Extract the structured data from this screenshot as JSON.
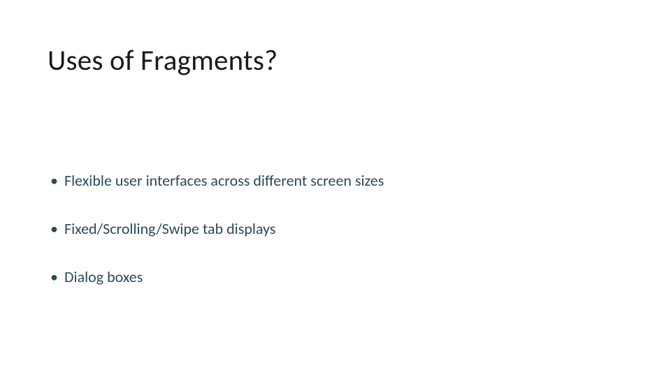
{
  "title": "Uses of Fragments?",
  "bullets": [
    "Flexible user interfaces across different screen sizes",
    "Fixed/Scrolling/Swipe tab displays",
    "Dialog boxes"
  ]
}
